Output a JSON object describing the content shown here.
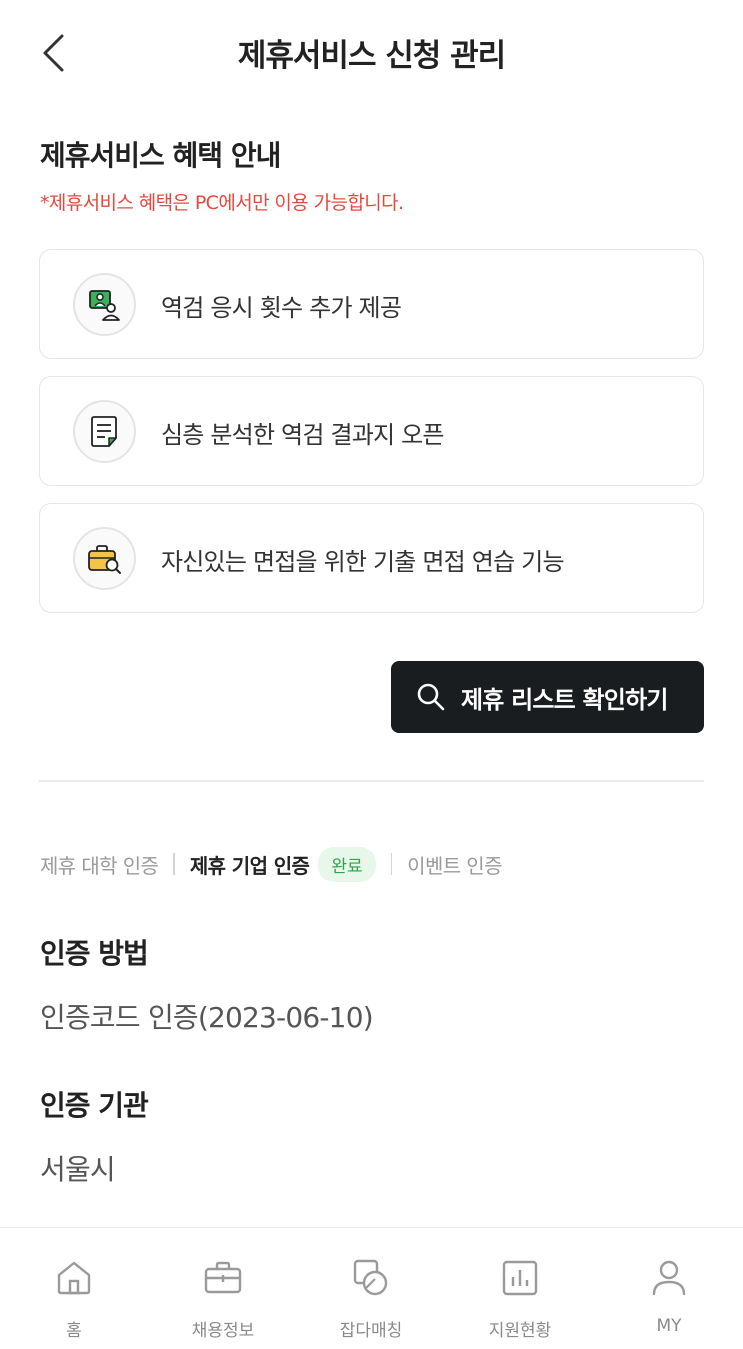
{
  "header": {
    "title": "제휴서비스 신청 관리"
  },
  "benefits": {
    "title": "제휴서비스 혜택 안내",
    "notice": "*제휴서비스 혜택은 PC에서만 이용 가능합니다.",
    "items": [
      {
        "icon": "aptitude-test-icon",
        "label": "역검 응시 횟수 추가 제공"
      },
      {
        "icon": "report-document-icon",
        "label": "심층 분석한 역검 결과지 오픈"
      },
      {
        "icon": "briefcase-search-icon",
        "label": "자신있는 면접을 위한 기출 면접 연습 기능"
      }
    ],
    "button_label": "제휴 리스트 확인하기"
  },
  "cert_tabs": {
    "university": "제휴 대학 인증",
    "company": "제휴 기업 인증",
    "company_badge": "완료",
    "event": "이벤트 인증"
  },
  "cert_info": {
    "method_label": "인증 방법",
    "method_value": "인증코드 인증(2023-06-10)",
    "org_label": "인증 기관",
    "org_value": "서울시"
  },
  "bottom_nav": {
    "home": "홈",
    "jobs": "채용정보",
    "matching": "잡다매칭",
    "status": "지원현황",
    "my": "MY"
  },
  "colors": {
    "notice": "#e8483f",
    "button_bg": "#1a1d1f",
    "badge_bg": "#e7f7ea",
    "badge_text": "#2fa34a",
    "icon_accent": "#3dae5a"
  }
}
